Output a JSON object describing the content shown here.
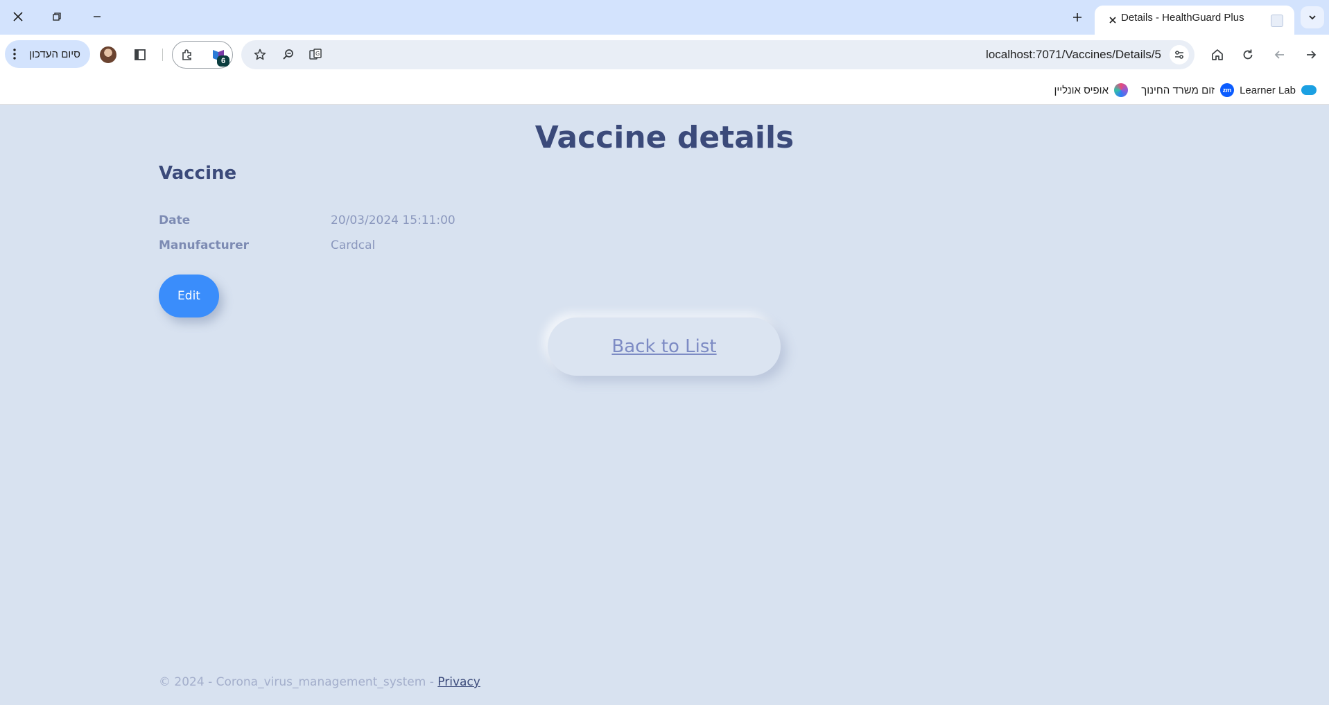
{
  "browser": {
    "tab_title": "Details - HealthGuard Plus",
    "update_button_label": "סיום העדכון",
    "extension_badge": "6",
    "url": "localhost:7071/Vaccines/Details/5",
    "bookmarks": [
      {
        "label": "Learner Lab",
        "icon": "cloud-icon",
        "color": "#1ba0e2"
      },
      {
        "label": "זום משרד החינוך",
        "icon": "zoom-icon",
        "color": "#0b5cff",
        "icon_text": "zm"
      },
      {
        "label": "אופיס אונליין",
        "icon": "office-icon",
        "color": "#8e5cd9"
      }
    ]
  },
  "page": {
    "title": "Vaccine details",
    "section_title": "Vaccine",
    "fields": [
      {
        "label": "Date",
        "value": "20/03/2024 15:11:00"
      },
      {
        "label": "Manufacturer",
        "value": "Cardcal"
      }
    ],
    "edit_label": "Edit",
    "back_label": "Back to List",
    "footer_text": "© 2024 - Corona_virus_management_system - ",
    "footer_link": "Privacy"
  },
  "colors": {
    "page_background": "#d8e2f0",
    "accent": "#3a8dfb",
    "heading": "#3b4a7a"
  }
}
